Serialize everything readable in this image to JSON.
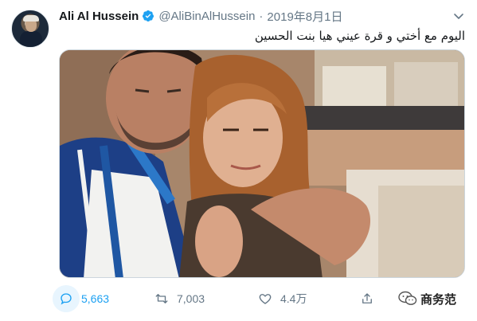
{
  "tweet": {
    "author_name": "Ali Al Hussein",
    "handle": "@AliBinAlHussein",
    "separator": "·",
    "date": "2019年8月1日",
    "text": "اليوم مع أختي و قرة عيني هيا بنت الحسين",
    "verified": true
  },
  "actions": {
    "reply_count": "5,663",
    "retweet_count": "7,003",
    "like_count": "4.4万"
  },
  "watermark": {
    "text": "商务范"
  },
  "icons": {
    "avatar": "profile-photo",
    "verified": "verified-badge-icon",
    "menu": "chevron-down-icon",
    "reply": "reply-icon",
    "retweet": "retweet-icon",
    "like": "heart-icon",
    "share": "share-icon",
    "watermark": "wechat-icon"
  },
  "colors": {
    "brand_blue": "#1da1f2",
    "text_primary": "#14171a",
    "text_secondary": "#657786",
    "reply_highlight": "#e8f5fe"
  }
}
